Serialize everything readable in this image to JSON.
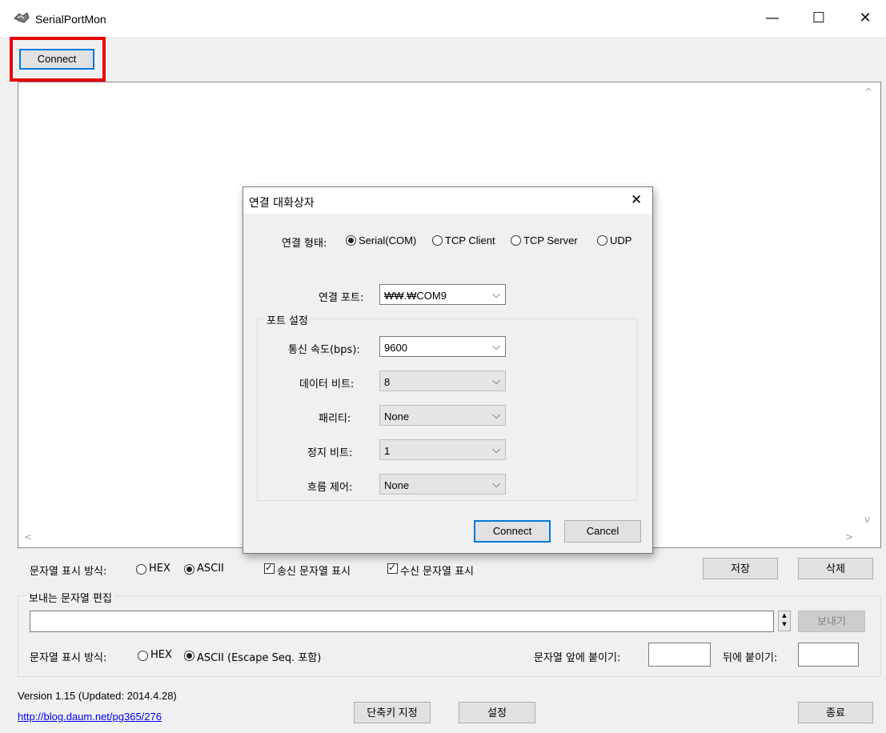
{
  "window": {
    "title": "SerialPortMon",
    "minimize": "—",
    "maximize": "☐",
    "close": "✕"
  },
  "toolbar": {
    "connect_label": "Connect"
  },
  "log_area": {
    "scroll_up": "^",
    "scroll_down": "v",
    "scroll_left": "<",
    "scroll_right": ">"
  },
  "display_options": {
    "label": "문자열 표시 방식:",
    "hex": "HEX",
    "ascii": "ASCII",
    "selected": "ASCII",
    "show_sent": "송신 문자열 표시",
    "show_received": "수신 문자열 표시",
    "save": "저장",
    "delete": "삭제"
  },
  "send_group": {
    "title": "보내는 문자열 편집",
    "input_value": "",
    "send_button": "보내기",
    "format_label": "문자열 표시 방식:",
    "hex": "HEX",
    "ascii": "ASCII (Escape Seq. 포함)",
    "prefix_label": "문자열 앞에 붙이기:",
    "suffix_label": "뒤에 붙이기:",
    "prefix_value": "",
    "suffix_value": ""
  },
  "footer": {
    "version": "Version 1.15 (Updated: 2014.4.28)",
    "link": "http://blog.daum.net/pg365/276",
    "shortcut_button": "단축키 지정",
    "settings_button": "설정",
    "exit_button": "종료"
  },
  "dialog": {
    "title": "연결 대화상자",
    "close": "✕",
    "conn_type_label": "연결 형태:",
    "conn_types": [
      "Serial(COM)",
      "TCP Client",
      "TCP Server",
      "UDP"
    ],
    "conn_type_selected": "Serial(COM)",
    "port_label": "연결 포트:",
    "port_value": "₩₩.₩COM9",
    "port_settings_title": "포트 설정",
    "baud_label": "통신 속도(bps):",
    "baud_value": "9600",
    "databits_label": "데이터 비트:",
    "databits_value": "8",
    "parity_label": "패리티:",
    "parity_value": "None",
    "stopbits_label": "정지 비트:",
    "stopbits_value": "1",
    "flow_label": "흐름 제어:",
    "flow_value": "None",
    "connect_button": "Connect",
    "cancel_button": "Cancel"
  },
  "colors": {
    "highlight": "#e8000b",
    "focus": "#0078d7",
    "link": "#0000ee"
  }
}
